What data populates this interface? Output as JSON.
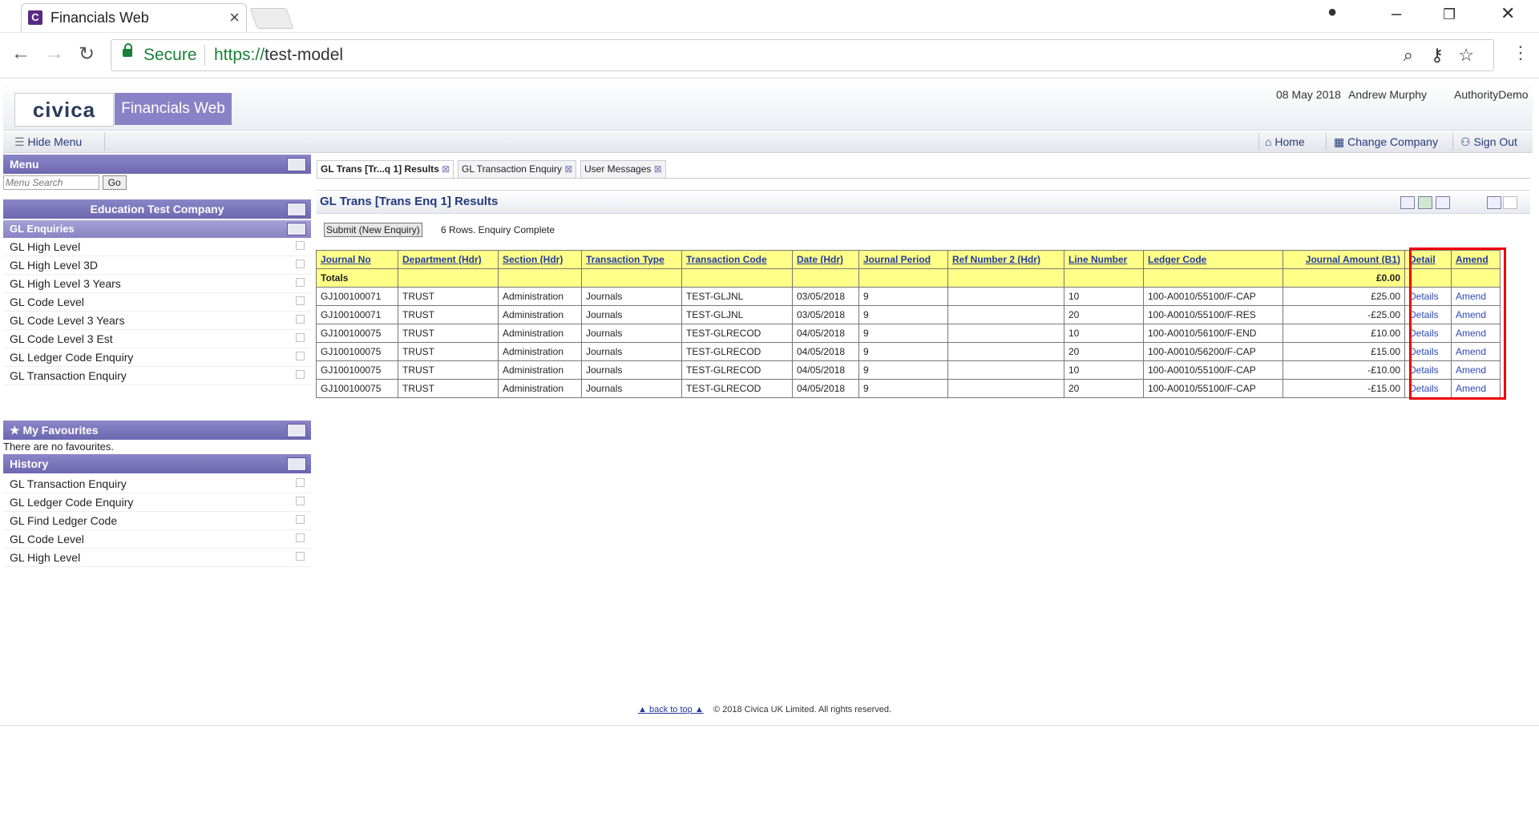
{
  "browser": {
    "tab_title": "Financials Web",
    "tab_favicon": "C",
    "secure_label": "Secure",
    "url_scheme": "https://",
    "url_host": "test-model"
  },
  "app": {
    "logo_text": "civica",
    "product_name": "Financials Web",
    "date": "08 May 2018",
    "user": "Andrew Murphy",
    "authority": "AuthorityDemo"
  },
  "toolbar": {
    "hide_menu": "Hide Menu",
    "home": "Home",
    "change_company": "Change Company",
    "sign_out": "Sign Out"
  },
  "sidebar": {
    "menu_title": "Menu",
    "search_placeholder": "Menu Search",
    "go_label": "Go",
    "company": "Education Test Company",
    "section_title": "GL Enquiries",
    "items": [
      "GL High Level",
      "GL High Level 3D",
      "GL High Level 3 Years",
      "GL Code Level",
      "GL Code Level 3 Years",
      "GL Code Level 3 Est",
      "GL Ledger Code Enquiry",
      "GL Transaction Enquiry"
    ],
    "favourites_title": "My Favourites",
    "favourites_empty": "There are no favourites.",
    "history_title": "History",
    "history": [
      "GL Transaction Enquiry",
      "GL Ledger Code Enquiry",
      "GL Find Ledger Code",
      "GL Code Level",
      "GL High Level"
    ]
  },
  "content": {
    "tabs": [
      "GL Trans [Tr...q 1] Results",
      "GL Transaction Enquiry",
      "User Messages"
    ],
    "title": "GL Trans [Trans Enq 1] Results",
    "submit_label": "Submit (New Enquiry)",
    "status": "6 Rows. Enquiry Complete"
  },
  "table": {
    "headers": [
      "Journal No",
      "Department (Hdr)",
      "Section (Hdr)",
      "Transaction Type",
      "Transaction Code",
      "Date (Hdr)",
      "Journal Period",
      "Ref Number 2 (Hdr)",
      "Line Number",
      "Ledger Code",
      "Journal Amount (B1)",
      "Detail",
      "Amend"
    ],
    "totals_label": "Totals",
    "totals_amount": "£0.00",
    "rows": [
      [
        "GJ100100071",
        "TRUST",
        "Administration",
        "Journals",
        "TEST-GLJNL",
        "03/05/2018",
        "9",
        "",
        "10",
        "100-A0010/55100/F-CAP",
        "£25.00",
        "Details",
        "Amend"
      ],
      [
        "GJ100100071",
        "TRUST",
        "Administration",
        "Journals",
        "TEST-GLJNL",
        "03/05/2018",
        "9",
        "",
        "20",
        "100-A0010/55100/F-RES",
        "-£25.00",
        "Details",
        "Amend"
      ],
      [
        "GJ100100075",
        "TRUST",
        "Administration",
        "Journals",
        "TEST-GLRECOD",
        "04/05/2018",
        "9",
        "",
        "10",
        "100-A0010/56100/F-END",
        "£10.00",
        "Details",
        "Amend"
      ],
      [
        "GJ100100075",
        "TRUST",
        "Administration",
        "Journals",
        "TEST-GLRECOD",
        "04/05/2018",
        "9",
        "",
        "20",
        "100-A0010/56200/F-CAP",
        "£15.00",
        "Details",
        "Amend"
      ],
      [
        "GJ100100075",
        "TRUST",
        "Administration",
        "Journals",
        "TEST-GLRECOD",
        "04/05/2018",
        "9",
        "",
        "10",
        "100-A0010/55100/F-CAP",
        "-£10.00",
        "Details",
        "Amend"
      ],
      [
        "GJ100100075",
        "TRUST",
        "Administration",
        "Journals",
        "TEST-GLRECOD",
        "04/05/2018",
        "9",
        "",
        "20",
        "100-A0010/55100/F-CAP",
        "-£15.00",
        "Details",
        "Amend"
      ]
    ]
  },
  "footer": {
    "back_to_top": "back to top",
    "copyright": "© 2018 Civica UK Limited. All rights reserved."
  },
  "colors": {
    "brand": "#8a82c7",
    "header_yellow": "#ffff88",
    "highlight": "#ee0000"
  }
}
